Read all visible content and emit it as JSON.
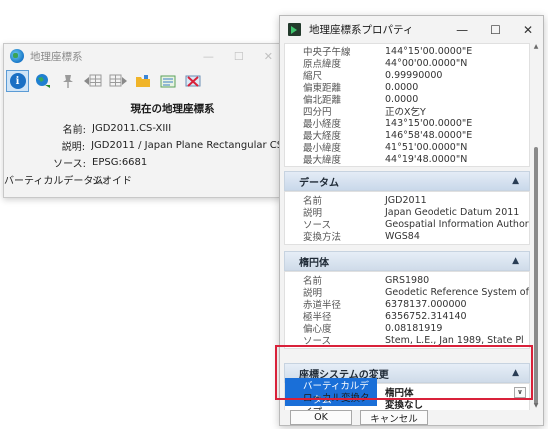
{
  "left_window": {
    "title": "地理座標系",
    "controls": [
      "—",
      "☐",
      "✕"
    ],
    "toolbar_icons": [
      "info-icon",
      "globe-refresh-icon",
      "pin-icon",
      "grid-left-icon",
      "grid-right-icon",
      "open-folder-icon",
      "list-icon",
      "remove-icon"
    ],
    "heading": "現在の地理座標系",
    "fields": [
      {
        "label": "名前:",
        "value": "JGD2011.CS-XIII"
      },
      {
        "label": "説明:",
        "value": "JGD2011 / Japan Plane Rectangular CS"
      },
      {
        "label": "ソース:",
        "value": "EPSG:6681"
      },
      {
        "label": "バーティカルデータム:",
        "value": "ジオイド"
      }
    ]
  },
  "right_window": {
    "title": "地理座標系プロパティ",
    "controls": [
      "—",
      "☐",
      "✕"
    ],
    "projection_rows": [
      {
        "label": "中央子午線",
        "value": "144°15'00.0000\"E"
      },
      {
        "label": "原点緯度",
        "value": "44°00'00.0000\"N"
      },
      {
        "label": "縮尺",
        "value": "0.99990000"
      },
      {
        "label": "偏東距離",
        "value": "0.0000"
      },
      {
        "label": "偏北距離",
        "value": "0.0000"
      },
      {
        "label": "四分円",
        "value": "正のX乞Y"
      },
      {
        "label": "最小経度",
        "value": "143°15'00.0000\"E"
      },
      {
        "label": "最大経度",
        "value": "146°58'48.0000\"E"
      },
      {
        "label": "最小緯度",
        "value": "41°51'00.0000\"N"
      },
      {
        "label": "最大緯度",
        "value": "44°19'48.0000\"N"
      }
    ],
    "datum_section": {
      "title": "データム",
      "rows": [
        {
          "label": "名前",
          "value": "JGD2011"
        },
        {
          "label": "説明",
          "value": "Japan Geodetic Datum 2011"
        },
        {
          "label": "ソース",
          "value": "Geospatial Information Author"
        },
        {
          "label": "変換方法",
          "value": "WGS84"
        }
      ]
    },
    "ellipsoid_section": {
      "title": "楕円体",
      "rows": [
        {
          "label": "名前",
          "value": "GRS1980"
        },
        {
          "label": "説明",
          "value": "Geodetic Reference System of"
        },
        {
          "label": "赤道半径",
          "value": "6378137.000000"
        },
        {
          "label": "極半径",
          "value": "6356752.314140"
        },
        {
          "label": "偏心度",
          "value": "0.08181919"
        },
        {
          "label": "ソース",
          "value": "Stem, L.E., Jan 1989, State Pl"
        }
      ]
    },
    "coord_change_section": {
      "title": "座標システムの変更",
      "rows": [
        {
          "label": "バーティカルデータム",
          "value": "楕円体"
        },
        {
          "label": "ローカル変換タイプ",
          "value": "変換なし"
        }
      ]
    },
    "buttons": {
      "ok": "OK",
      "cancel": "キャンセル"
    },
    "caret": "▲"
  }
}
